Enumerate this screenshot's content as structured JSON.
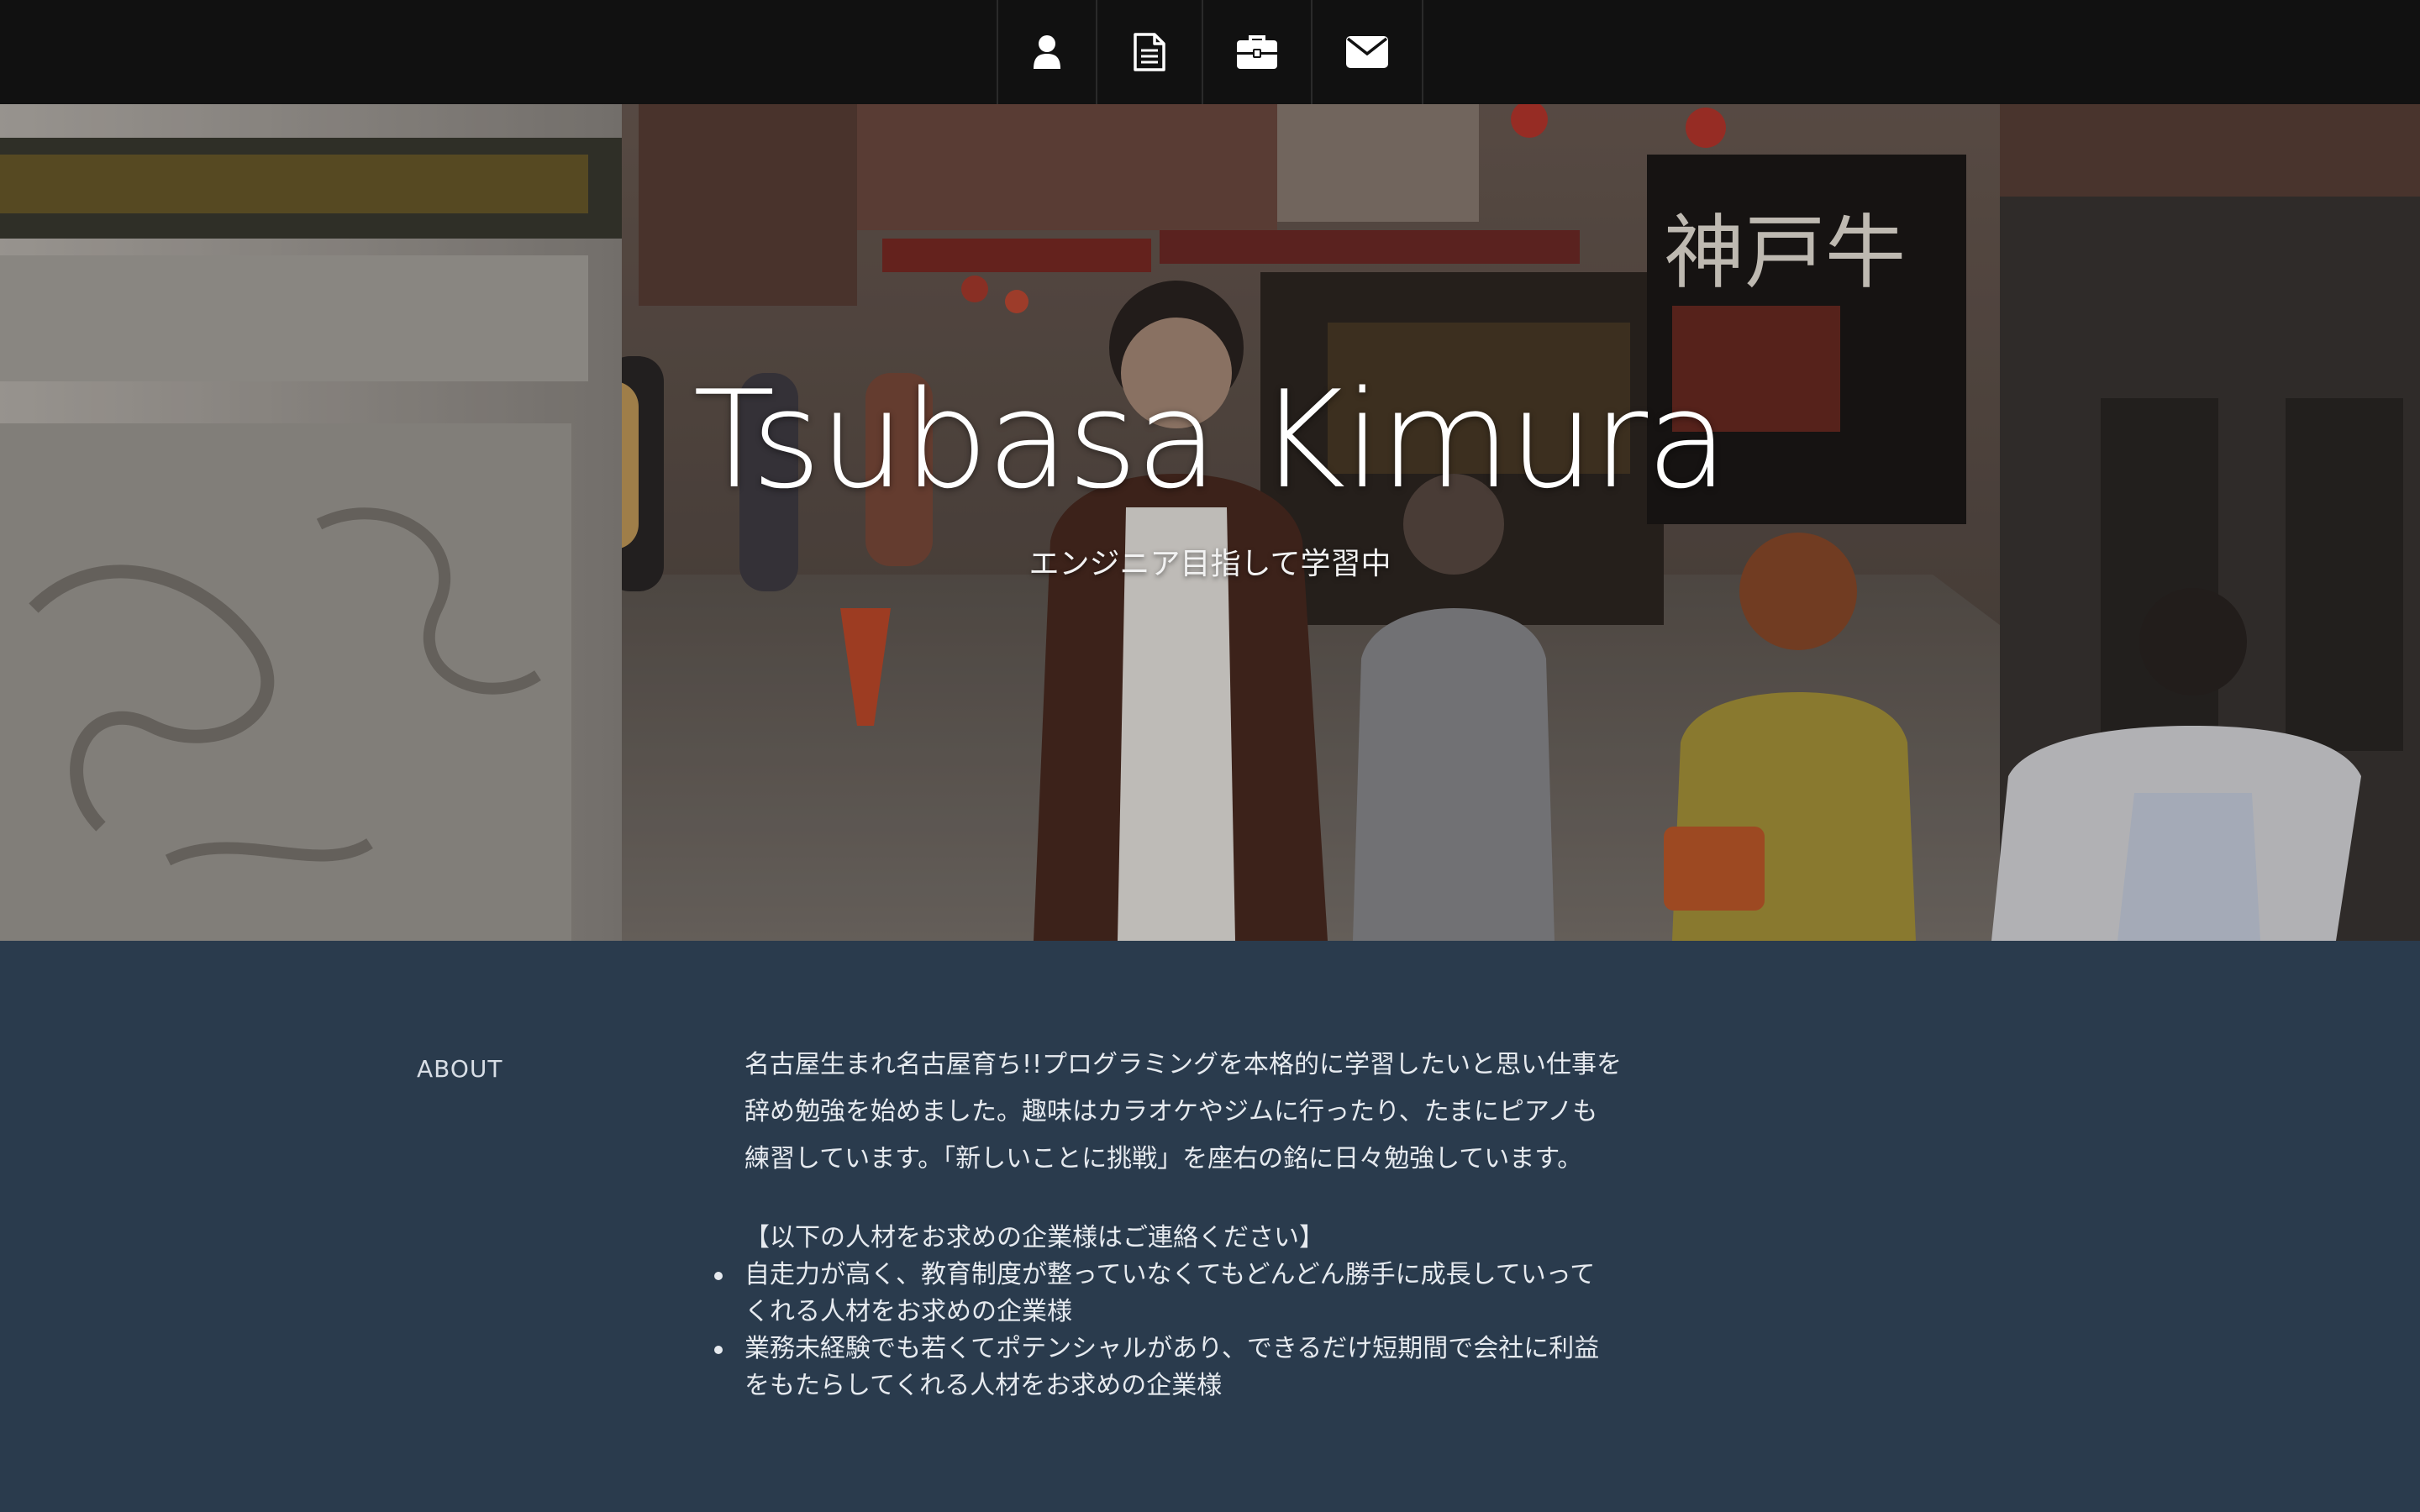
{
  "nav": {
    "items": [
      {
        "icon": "user-icon"
      },
      {
        "icon": "document-icon"
      },
      {
        "icon": "briefcase-icon"
      },
      {
        "icon": "envelope-icon"
      }
    ]
  },
  "hero": {
    "name": "Tsubasa Kimura",
    "subtitle": "エンジニア目指して学習中",
    "sign_text": "神戸牛"
  },
  "about": {
    "label": "ABOUT",
    "paragraph_lines": [
      "名古屋生まれ名古屋育ち!!プログラミングを本格的に学習したいと思い仕事を",
      "辞め勉強を始めました。趣味はカラオケやジムに行ったり、たまにピアノも",
      "練習しています。「新しいことに挑戦」を座右の銘に日々勉強しています。"
    ],
    "wanted_heading": "【以下の人材をお求めの企業様はご連絡ください】",
    "wanted_items": [
      {
        "line1": "自走力が高く、教育制度が整っていなくてもどんどん勝手に成長していって",
        "line2": "くれる人材をお求めの企業様"
      },
      {
        "line1": "業務未経験でも若くてポテンシャルがあり、できるだけ短期間で会社に利益",
        "line2": "をもたらしてくれる人材をお求めの企業様"
      }
    ]
  },
  "colors": {
    "navbar_bg": "#111111",
    "about_bg": "#2a3b4d",
    "text": "#ffffff"
  }
}
